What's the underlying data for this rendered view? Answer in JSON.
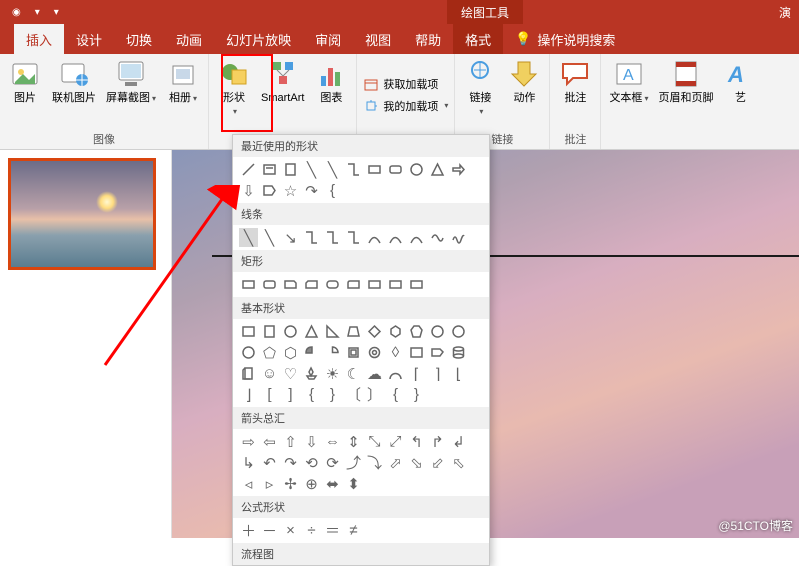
{
  "titlebar": {
    "context_tab": "绘图工具",
    "right_text": "演"
  },
  "tabs": {
    "insert": "插入",
    "design": "设计",
    "transition": "切换",
    "animation": "动画",
    "slideshow": "幻灯片放映",
    "review": "审阅",
    "view": "视图",
    "help": "帮助",
    "format": "格式",
    "tell_me": "操作说明搜索"
  },
  "ribbon": {
    "pictures": "图片",
    "online_pictures": "联机图片",
    "screenshot": "屏幕截图",
    "album": "相册",
    "images_group": "图像",
    "shapes": "形状",
    "smartart": "SmartArt",
    "chart": "图表",
    "get_addins": "获取加载项",
    "my_addins": "我的加载项",
    "link": "链接",
    "action": "动作",
    "links_group": "链接",
    "comment": "批注",
    "comments_group": "批注",
    "text_box": "文本框",
    "header_footer": "页眉和页脚",
    "wordart": "艺"
  },
  "gallery": {
    "recent": "最近使用的形状",
    "lines": "线条",
    "rectangles": "矩形",
    "basic": "基本形状",
    "block_arrows": "箭头总汇",
    "equation": "公式形状",
    "flowchart": "流程图"
  },
  "watermark": "@51CTO博客"
}
